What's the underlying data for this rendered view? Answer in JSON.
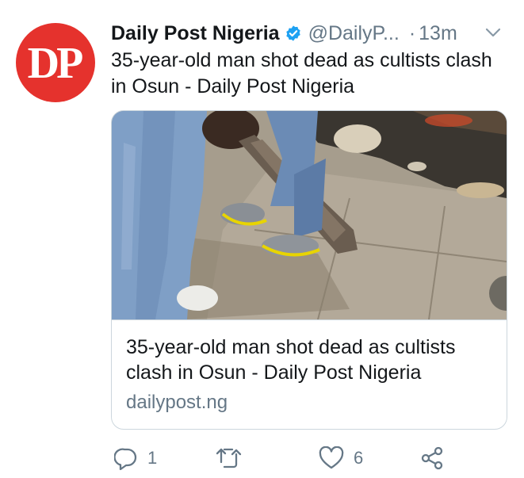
{
  "avatar": {
    "initials": "DP",
    "color": "#e5322d"
  },
  "author": {
    "name": "Daily Post Nigeria",
    "verified": true,
    "handle": "@DailyP...",
    "separator": "·",
    "time": "13m"
  },
  "tweet": {
    "text": "35-year-old man shot dead as cultists clash in Osun - Daily Post Nigeria"
  },
  "card": {
    "title": "35-year-old man shot dead as cultists clash in Osun - Daily Post Nigeria",
    "domain": "dailypost.ng"
  },
  "actions": {
    "reply_count": "1",
    "like_count": "6"
  },
  "colors": {
    "text": "#14171a",
    "secondary": "#657786",
    "verified": "#1da1f2",
    "border": "#ccd6dd"
  }
}
